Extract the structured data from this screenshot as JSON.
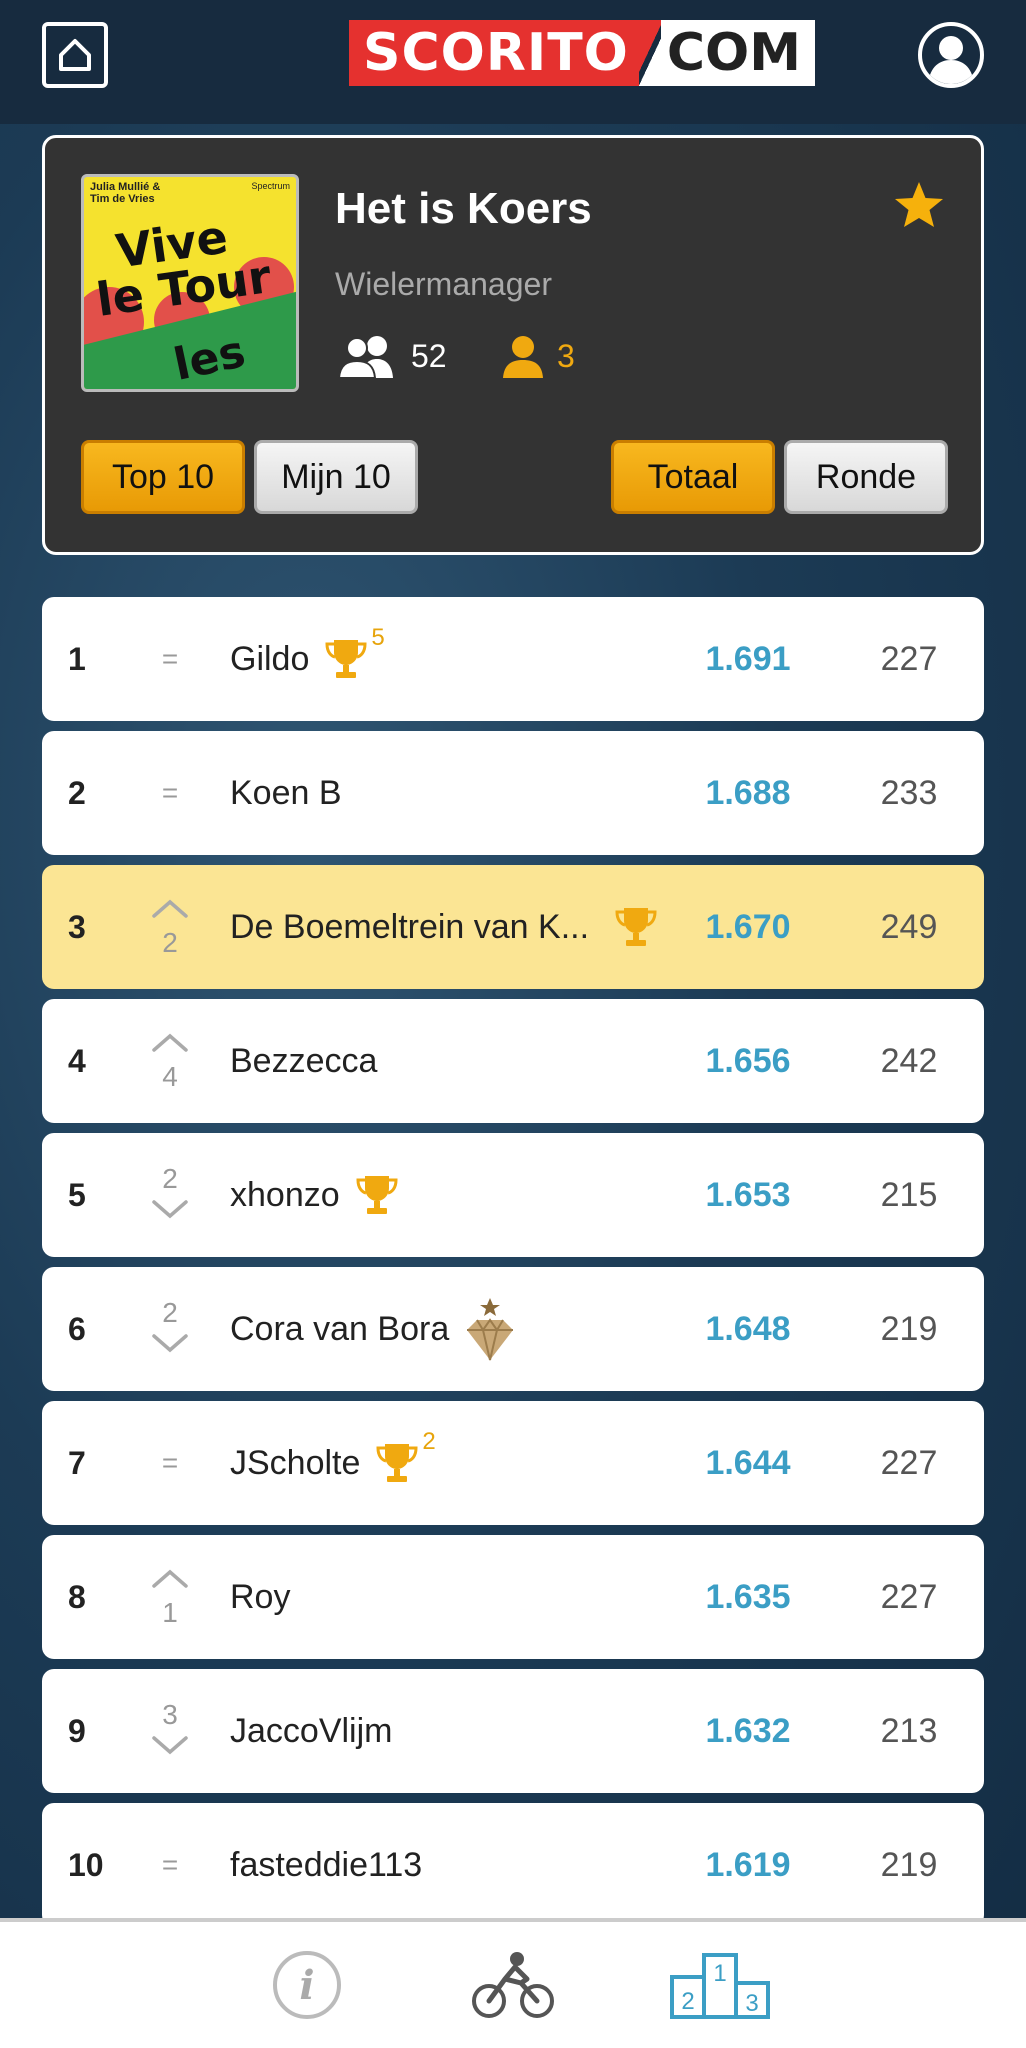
{
  "header": {
    "logo_left": "SCORITO",
    "logo_right": "COM"
  },
  "league": {
    "title": "Het is Koers",
    "subtitle": "Wielermanager",
    "members": "52",
    "mine": "3",
    "cover": {
      "authors": "Julia Mullié & Tim de Vries",
      "publisher": "Spectrum",
      "title_line1": "Vive",
      "title_line2": "le Tour",
      "title_line3": "les"
    },
    "tabs": {
      "top10": "Top 10",
      "mijn10": "Mijn 10",
      "totaal": "Totaal",
      "ronde": "Ronde"
    }
  },
  "colors": {
    "accent": "#f0a910",
    "points": "#3b9ec5",
    "highlight": "#fbe594"
  },
  "rankings": [
    {
      "rank": "1",
      "move": "=",
      "move_dir": "same",
      "name": "Gildo",
      "badge": "trophy",
      "badge_count": "5",
      "points": "1.691",
      "total": "227"
    },
    {
      "rank": "2",
      "move": "=",
      "move_dir": "same",
      "name": "Koen B",
      "badge": "",
      "badge_count": "",
      "points": "1.688",
      "total": "233"
    },
    {
      "rank": "3",
      "move": "2",
      "move_dir": "up",
      "name": "De Boemeltrein van K...",
      "badge": "trophy",
      "badge_count": "",
      "points": "1.670",
      "total": "249",
      "highlight": true
    },
    {
      "rank": "4",
      "move": "4",
      "move_dir": "up",
      "name": "Bezzecca",
      "badge": "",
      "badge_count": "",
      "points": "1.656",
      "total": "242"
    },
    {
      "rank": "5",
      "move": "2",
      "move_dir": "down",
      "name": "xhonzo",
      "badge": "trophy",
      "badge_count": "",
      "points": "1.653",
      "total": "215"
    },
    {
      "rank": "6",
      "move": "2",
      "move_dir": "down",
      "name": "Cora van Bora",
      "badge": "diamond",
      "badge_count": "",
      "points": "1.648",
      "total": "219"
    },
    {
      "rank": "7",
      "move": "=",
      "move_dir": "same",
      "name": "JScholte",
      "badge": "trophy",
      "badge_count": "2",
      "points": "1.644",
      "total": "227"
    },
    {
      "rank": "8",
      "move": "1",
      "move_dir": "up",
      "name": "Roy",
      "badge": "",
      "badge_count": "",
      "points": "1.635",
      "total": "227"
    },
    {
      "rank": "9",
      "move": "3",
      "move_dir": "down",
      "name": "JaccoVlijm",
      "badge": "",
      "badge_count": "",
      "points": "1.632",
      "total": "213"
    },
    {
      "rank": "10",
      "move": "=",
      "move_dir": "same",
      "name": "fasteddie113",
      "badge": "",
      "badge_count": "",
      "points": "1.619",
      "total": "219"
    }
  ],
  "bottom_nav": {
    "items": [
      {
        "icon": "info-icon"
      },
      {
        "icon": "cyclist-icon"
      },
      {
        "icon": "podium-icon",
        "active": true,
        "podium_labels": [
          "1",
          "2",
          "3"
        ]
      }
    ]
  }
}
